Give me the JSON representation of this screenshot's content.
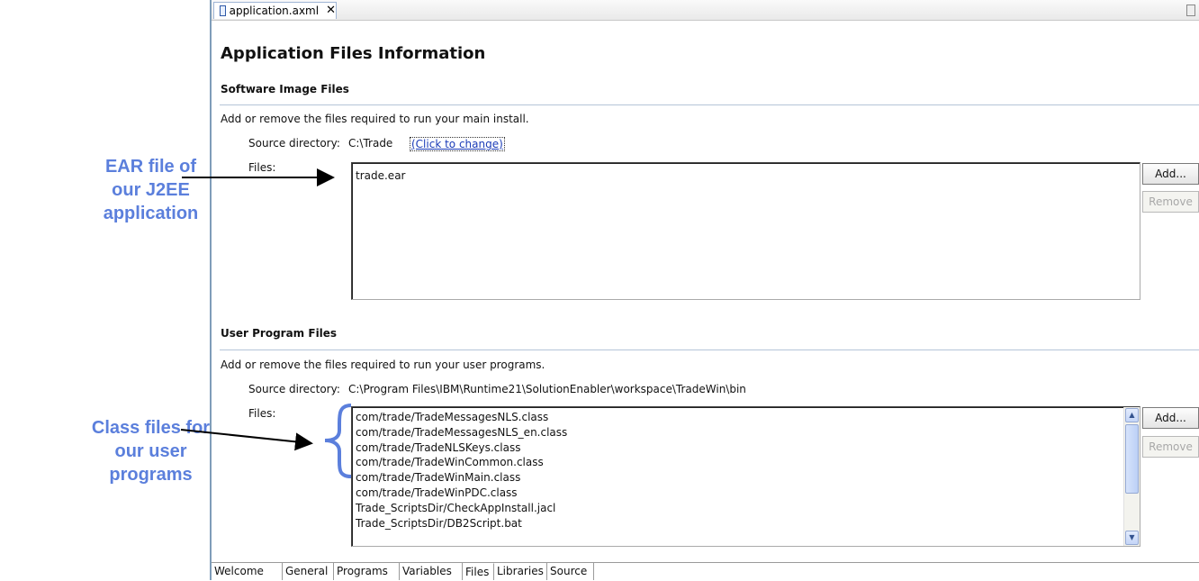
{
  "tab": {
    "label": "application.axml",
    "close": "✕"
  },
  "page_title": "Application Files Information",
  "software": {
    "header": "Software Image Files",
    "desc": "Add or remove the files required to run your main install.",
    "src_label": "Source directory:",
    "src_value": "C:\\Trade",
    "change_link": "(Click to change)",
    "files_label": "Files:",
    "files": [
      "trade.ear"
    ],
    "add_label": "Add...",
    "remove_label": "Remove"
  },
  "user": {
    "header": "User Program Files",
    "desc": "Add or remove the files required to run your user programs.",
    "src_label": "Source directory:",
    "src_value": "C:\\Program Files\\IBM\\Runtime21\\SolutionEnabler\\workspace\\TradeWin\\bin",
    "files_label": "Files:",
    "files": [
      "com/trade/TradeMessagesNLS.class",
      "com/trade/TradeMessagesNLS_en.class",
      "com/trade/TradeNLSKeys.class",
      "com/trade/TradeWinCommon.class",
      "com/trade/TradeWinMain.class",
      "com/trade/TradeWinPDC.class",
      "Trade_ScriptsDir/CheckAppInstall.jacl",
      "Trade_ScriptsDir/DB2Script.bat"
    ],
    "add_label": "Add...",
    "remove_label": "Remove"
  },
  "bottom_tabs": [
    "Welcome",
    "General",
    "Programs",
    "Variables",
    "Files",
    "Libraries",
    "Source"
  ],
  "active_bottom_tab": "Files",
  "annotations": {
    "ear": [
      "EAR file of",
      "our J2EE",
      "application"
    ],
    "class": [
      "Class files for",
      "our user",
      "programs"
    ]
  },
  "colors": {
    "annotation": "#5b7fdc",
    "link": "#1b3cb8"
  }
}
